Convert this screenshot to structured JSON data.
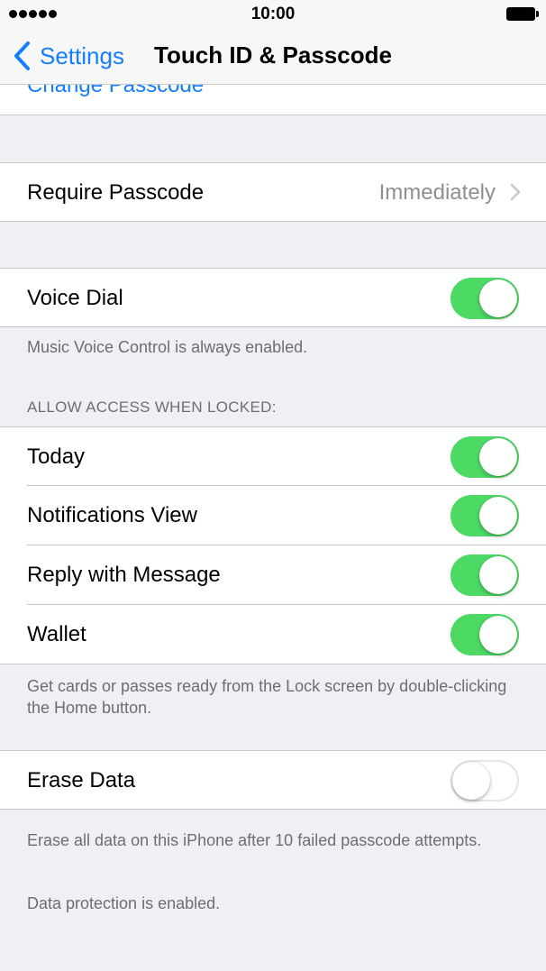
{
  "status_bar": {
    "time": "10:00",
    "signal_icon": "signal-dots-icon",
    "battery_icon": "battery-icon"
  },
  "nav": {
    "back_label": "Settings",
    "back_icon": "chevron-left-icon",
    "title": "Touch ID & Passcode"
  },
  "change_passcode": {
    "label": "Change Passcode"
  },
  "require_passcode": {
    "label": "Require Passcode",
    "value": "Immediately"
  },
  "voice_dial": {
    "label": "Voice Dial",
    "enabled": true,
    "footer": "Music Voice Control is always enabled."
  },
  "allow_access": {
    "header": "ALLOW ACCESS WHEN LOCKED:",
    "items": [
      {
        "label": "Today",
        "enabled": true
      },
      {
        "label": "Notifications View",
        "enabled": true
      },
      {
        "label": "Reply with Message",
        "enabled": true
      },
      {
        "label": "Wallet",
        "enabled": true
      }
    ],
    "footer": "Get cards or passes ready from the Lock screen by double-clicking the Home button."
  },
  "erase_data": {
    "label": "Erase Data",
    "enabled": false,
    "footer": "Erase all data on this iPhone after 10 failed passcode attempts.",
    "footer2": "Data protection is enabled."
  },
  "colors": {
    "accent": "#147efb",
    "switch_on": "#4cd964",
    "background": "#efeff4"
  }
}
